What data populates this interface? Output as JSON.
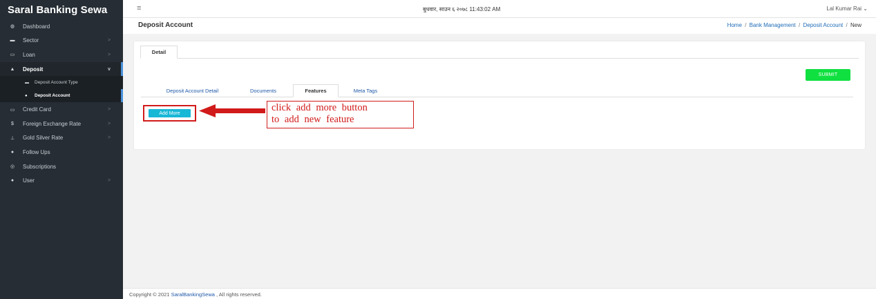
{
  "app": {
    "brand": "Saral Banking Sewa"
  },
  "sidebar": {
    "items": [
      {
        "label": "Dashboard",
        "icon": "dashboard-icon",
        "glyph": "◍",
        "chevron": ""
      },
      {
        "label": "Sector",
        "icon": "sector-icon",
        "glyph": "▬",
        "chevron": ">"
      },
      {
        "label": "Loan",
        "icon": "loan-icon",
        "glyph": "▭",
        "chevron": ">"
      },
      {
        "label": "Deposit",
        "icon": "deposit-icon",
        "glyph": "▲",
        "chevron": "v"
      },
      {
        "label": "Credit Card",
        "icon": "credit-card-icon",
        "glyph": "▭",
        "chevron": ">"
      },
      {
        "label": "Foreign Exchange Rate",
        "icon": "dollar-icon",
        "glyph": "$",
        "chevron": ">"
      },
      {
        "label": "Gold Silver Rate",
        "icon": "gold-icon",
        "glyph": "⊥",
        "chevron": ">"
      },
      {
        "label": "Follow Ups",
        "icon": "user-plus-icon",
        "glyph": "●",
        "chevron": ""
      },
      {
        "label": "Subscriptions",
        "icon": "subscriptions-icon",
        "glyph": "◎",
        "chevron": ""
      },
      {
        "label": "User",
        "icon": "users-icon",
        "glyph": "●",
        "chevron": ">"
      }
    ],
    "deposit_sub": [
      {
        "label": "Deposit Account Type",
        "icon": "card-icon",
        "glyph": "▬"
      },
      {
        "label": "Deposit Account",
        "icon": "user-circle-icon",
        "glyph": "●"
      }
    ]
  },
  "topbar": {
    "menu_glyph": "≡",
    "datetime": "बुधवार, साउन ६ २०७८ 11:43:02 AM",
    "user": "Lal Kumar Rai ⌄"
  },
  "header": {
    "title": "Deposit Account",
    "breadcrumb": {
      "home": "Home",
      "section": "Bank Management",
      "page": "Deposit Account",
      "current": "New",
      "separator": "/"
    }
  },
  "card": {
    "tab": "Detail",
    "submit": "SUBMIT",
    "inner_tabs": [
      "Deposit Account Detail",
      "Documents",
      "Features",
      "Meta Tags"
    ],
    "add_more": "Add More",
    "annotation": {
      "line1": "click add more button",
      "line2": "to add new feature",
      "color": "#d11a1a"
    }
  },
  "footer": {
    "prefix": "Copyright © 2021 ",
    "link": "SaralBankingSewa",
    "suffix": " , All rights reserved."
  },
  "colors": {
    "sidebar_bg": "#262d34",
    "submit_green": "#10e040",
    "add_more_cyan": "#17b7d6",
    "link_blue": "#1e58a8"
  }
}
